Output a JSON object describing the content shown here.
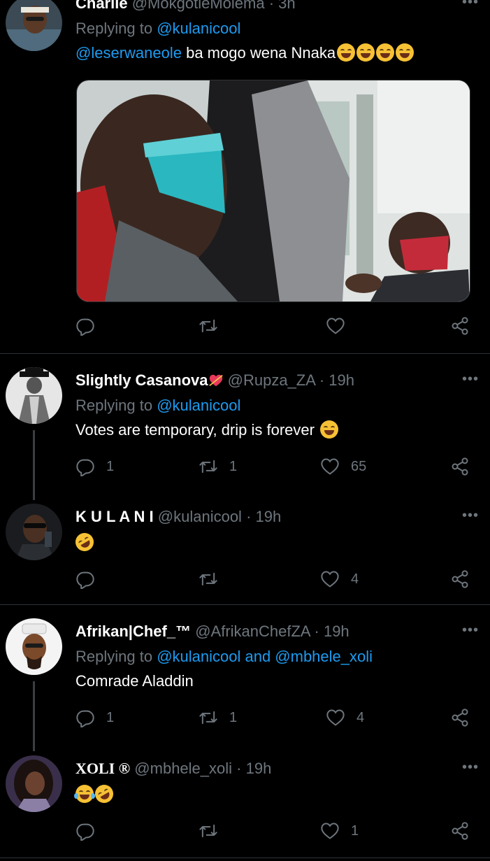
{
  "tweets": [
    {
      "name": "Charlie",
      "handle": "@MokgotleMolema",
      "time": "· 3h",
      "replying_label": "Replying to ",
      "replying_to": "@kulanicool",
      "mention": "@leserwaneole",
      "text": " ba mogo wena Nnaka",
      "emojis": [
        "tears-of-joy",
        "tears-of-joy",
        "tears-of-joy",
        "tears-of-joy"
      ],
      "counts": {
        "reply": "",
        "retweet": "",
        "like": ""
      }
    },
    {
      "name": "Slightly Casanova",
      "handle": "@Rupza_ZA",
      "time": "· 19h",
      "replying_label": "Replying to ",
      "replying_to": "@kulanicool",
      "text": "Votes are temporary,  drip is forever",
      "emojis": [
        "laughing-squint"
      ],
      "counts": {
        "reply": "1",
        "retweet": "1",
        "like": "65"
      }
    },
    {
      "name": "K U L A N I",
      "handle": "@kulanicool",
      "time": "· 19h",
      "emojis": [
        "rolling-on-floor-laughing"
      ],
      "counts": {
        "reply": "",
        "retweet": "",
        "like": "4"
      }
    },
    {
      "name": "Afrikan|Chef_™",
      "handle": "@AfrikanChefZA",
      "time": "· 19h",
      "replying_label": "Replying to ",
      "replying_to": "@kulanicool and @mbhele_xoli",
      "text": "Comrade Aladdin",
      "counts": {
        "reply": "1",
        "retweet": "1",
        "like": "4"
      }
    },
    {
      "name": "XOLI ®",
      "handle": "@mbhele_xoli",
      "time": "· 19h",
      "emojis": [
        "loudly-crying",
        "rolling-on-floor-laughing"
      ],
      "counts": {
        "reply": "",
        "retweet": "",
        "like": "1"
      }
    }
  ],
  "icons": {
    "reply": "reply-icon",
    "retweet": "retweet-icon",
    "like": "heart-icon",
    "share": "share-icon",
    "more": "more-icon"
  },
  "colors": {
    "background": "#000000",
    "link": "#1d9bf0",
    "secondary_text": "#6e767d",
    "divider": "#2f3336"
  }
}
